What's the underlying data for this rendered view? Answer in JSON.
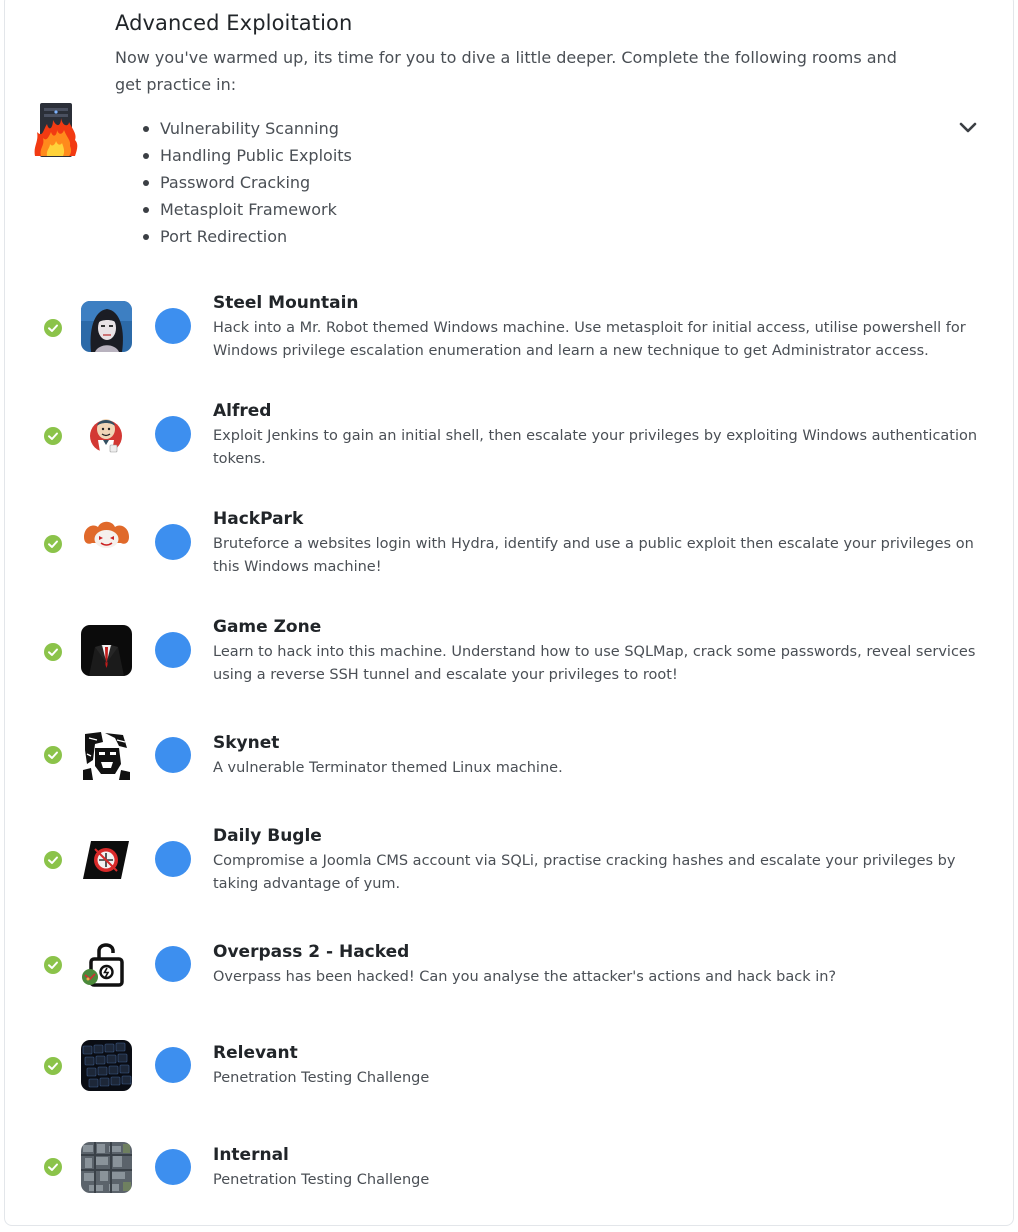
{
  "path": {
    "title": "Advanced Exploitation",
    "description": "Now you've warmed up, its time for you to dive a little deeper. Complete the following rooms and get practice in:",
    "topics": [
      "Vulnerability Scanning",
      "Handling Public Exploits",
      "Password Cracking",
      "Metasploit Framework",
      "Port Redirection"
    ]
  },
  "colors": {
    "check_green": "#8bc34a",
    "progress_blue": "#3d8fef",
    "title_text": "#212529",
    "body_text": "#4a4f55"
  },
  "rooms": [
    {
      "title": "Steel Mountain",
      "description": "Hack into a Mr. Robot themed Windows machine. Use metasploit for initial access, utilise powershell for Windows privilege escalation enumeration and learn a new technique to get Administrator access.",
      "icon": "mr-robot-portrait-icon",
      "completed": true
    },
    {
      "title": "Alfred",
      "description": "Exploit Jenkins to gain an initial shell, then escalate your privileges by exploiting Windows authentication tokens.",
      "icon": "jenkins-butler-icon",
      "completed": true
    },
    {
      "title": "HackPark",
      "description": "Bruteforce a websites login with Hydra, identify and use a public exploit then escalate your privileges on this Windows machine!",
      "icon": "clown-icon",
      "completed": true
    },
    {
      "title": "Game Zone",
      "description": "Learn to hack into this machine. Understand how to use SQLMap, crack some passwords, reveal services using a reverse SSH tunnel and escalate your privileges to root!",
      "icon": "suit-agent-icon",
      "completed": true
    },
    {
      "title": "Skynet",
      "description": "A vulnerable Terminator themed Linux machine.",
      "icon": "terminator-icon",
      "completed": true
    },
    {
      "title": "Daily Bugle",
      "description": "Compromise a Joomla CMS account via SQLi, practise cracking hashes and escalate your privileges by taking advantage of yum.",
      "icon": "daily-bugle-logo-icon",
      "completed": true
    },
    {
      "title": "Overpass 2 - Hacked",
      "description": "Overpass has been hacked! Can you analyse the attacker's actions and hack back in?",
      "icon": "unlocked-padlock-icon",
      "completed": true
    },
    {
      "title": "Relevant",
      "description": "Penetration Testing Challenge",
      "icon": "keyboard-icon",
      "completed": true
    },
    {
      "title": "Internal",
      "description": "Penetration Testing Challenge",
      "icon": "city-aerial-icon",
      "completed": true
    }
  ]
}
